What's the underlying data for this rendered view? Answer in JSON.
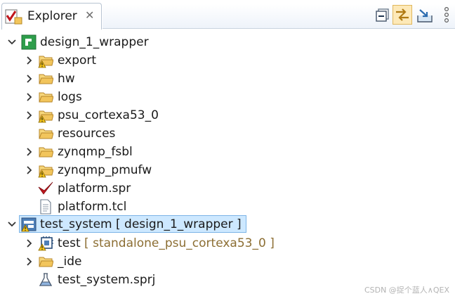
{
  "view": {
    "tab_label": "Explorer",
    "tab_icon": "explorer-icon",
    "close_glyph": "✕",
    "toolbar": [
      {
        "name": "collapse-all-icon"
      },
      {
        "name": "link-with-editor-icon",
        "active": true
      },
      {
        "name": "export-icon"
      },
      {
        "name": "view-menu-icon"
      }
    ]
  },
  "tree": {
    "platform": {
      "label": "design_1_wrapper",
      "icon": "platform-project-icon",
      "expanded": true,
      "children": [
        {
          "label": "export",
          "icon": "warning-folder-icon",
          "expandable": true
        },
        {
          "label": "hw",
          "icon": "folder-icon",
          "expandable": true
        },
        {
          "label": "logs",
          "icon": "folder-icon",
          "expandable": true
        },
        {
          "label": "psu_cortexa53_0",
          "icon": "warning-folder-icon",
          "expandable": true
        },
        {
          "label": "resources",
          "icon": "folder-icon",
          "expandable": false
        },
        {
          "label": "zynqmp_fsbl",
          "icon": "folder-icon",
          "expandable": true
        },
        {
          "label": "zynqmp_pmufw",
          "icon": "warning-folder-icon",
          "expandable": true
        },
        {
          "label": "platform.spr",
          "icon": "xilinx-spr-icon",
          "expandable": false
        },
        {
          "label": "platform.tcl",
          "icon": "text-file-icon",
          "expandable": false
        }
      ]
    },
    "system": {
      "label": "test_system [ design_1_wrapper ]",
      "icon": "system-project-warning-icon",
      "expanded": true,
      "selected": true,
      "children": [
        {
          "label": "test",
          "decoration": " [ standalone_psu_cortexa53_0 ]",
          "icon": "application-warning-icon",
          "expandable": true
        },
        {
          "label": "_ide",
          "icon": "folder-icon",
          "expandable": true
        },
        {
          "label": "test_system.sprj",
          "icon": "flask-file-icon",
          "expandable": false
        }
      ]
    }
  },
  "watermark": "CSDN @捉个蓝人∧QEX",
  "colors": {
    "folder": "#f2c55c",
    "warning": "#f5c518",
    "selection_bg": "#cde8ff",
    "selection_border": "#7db4e6",
    "decoration_text": "#8c6e33",
    "platform_green": "#2e9e4b",
    "xilinx_red": "#c0161d"
  }
}
